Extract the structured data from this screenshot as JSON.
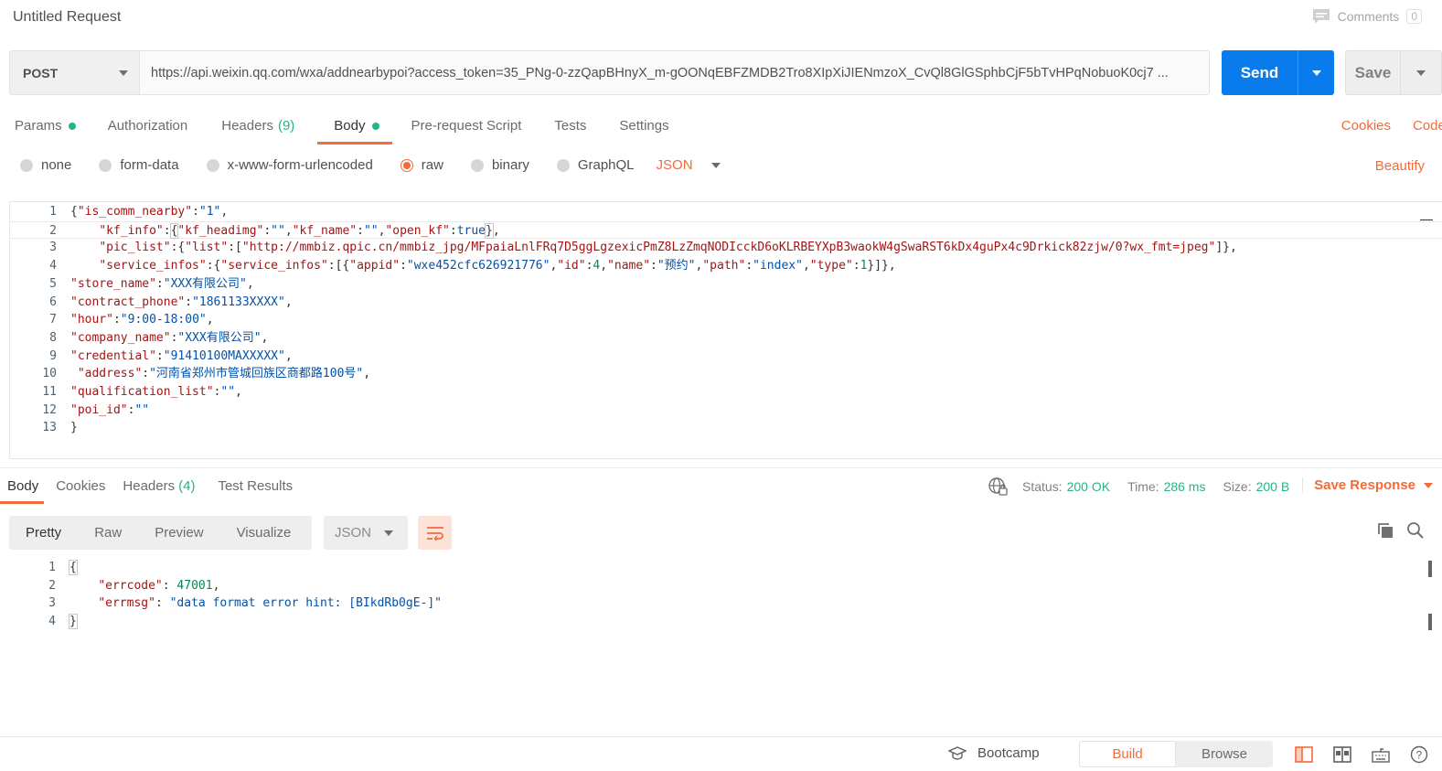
{
  "window": {
    "title": "Untitled Request"
  },
  "comments": {
    "label": "Comments",
    "count": "0"
  },
  "request": {
    "method": "POST",
    "url": "https://api.weixin.qq.com/wxa/addnearbypoi?access_token=35_PNg-0-zzQapBHnyX_m-gOONqEBFZMDB2Tro8XIpXiJIENmzoX_CvQl8GlGSphbCjF5bTvHPqNobuoK0cj7 ...",
    "send_label": "Send",
    "save_label": "Save"
  },
  "tabs": [
    {
      "label": "Params",
      "dot": true
    },
    {
      "label": "Authorization"
    },
    {
      "label": "Headers",
      "count": "(9)"
    },
    {
      "label": "Body",
      "dot": true,
      "active": true
    },
    {
      "label": "Pre-request Script"
    },
    {
      "label": "Tests"
    },
    {
      "label": "Settings"
    }
  ],
  "right_links": {
    "cookies": "Cookies",
    "code": "Code"
  },
  "body_types": {
    "options": [
      "none",
      "form-data",
      "x-www-form-urlencoded",
      "raw",
      "binary",
      "GraphQL"
    ],
    "selected": "raw",
    "language": "JSON",
    "beautify": "Beautify"
  },
  "request_body_lines": [
    "{\"is_comm_nearby\":\"1\",",
    "    \"kf_info\":{\"kf_headimg\":\"\",\"kf_name\":\"\",\"open_kf\":true},",
    "    \"pic_list\":{\"list\":[\"http://mmbiz.qpic.cn/mmbiz_jpg/MFpaiaLnlFRq7D5ggLgzexicPmZ8LzZmqNODIcckD6oKLRBEYXpB3waokW4gSwaRST6kDx4guPx4c9Drkick82zjw/0?wx_fmt=jpeg\"]},",
    "    \"service_infos\":{\"service_infos\":[{\"appid\":\"wxe452cfc626921776\",\"id\":4,\"name\":\"预约\",\"path\":\"index\",\"type\":1}]},",
    "\"store_name\":\"XXX有限公司\",",
    "\"contract_phone\":\"1861133XXXX\",",
    "\"hour\":\"9:00-18:00\",",
    "\"company_name\":\"XXX有限公司\",",
    "\"credential\":\"91410100MAXXXXX\",",
    " \"address\":\"河南省郑州市管城回族区商都路100号\",",
    "\"qualification_list\":\"\",",
    "\"poi_id\":\"\"",
    "}"
  ],
  "response": {
    "tabs": [
      {
        "label": "Body",
        "active": true
      },
      {
        "label": "Cookies"
      },
      {
        "label": "Headers",
        "count": "(4)"
      },
      {
        "label": "Test Results"
      }
    ],
    "status_label": "Status:",
    "status_value": "200 OK",
    "time_label": "Time:",
    "time_value": "286 ms",
    "size_label": "Size:",
    "size_value": "200 B",
    "save_response": "Save Response",
    "views": [
      "Pretty",
      "Raw",
      "Preview",
      "Visualize"
    ],
    "active_view": "Pretty",
    "format": "JSON",
    "body_lines": [
      "{",
      "    \"errcode\": 47001,",
      "    \"errmsg\": \"data format error hint: [BIkdRb0gE-]\"",
      "}"
    ]
  },
  "footer": {
    "bootcamp": "Bootcamp",
    "build": "Build",
    "browse": "Browse"
  },
  "colors": {
    "accent": "#f26b3a",
    "send": "#097bed",
    "ok": "#26b47f"
  }
}
